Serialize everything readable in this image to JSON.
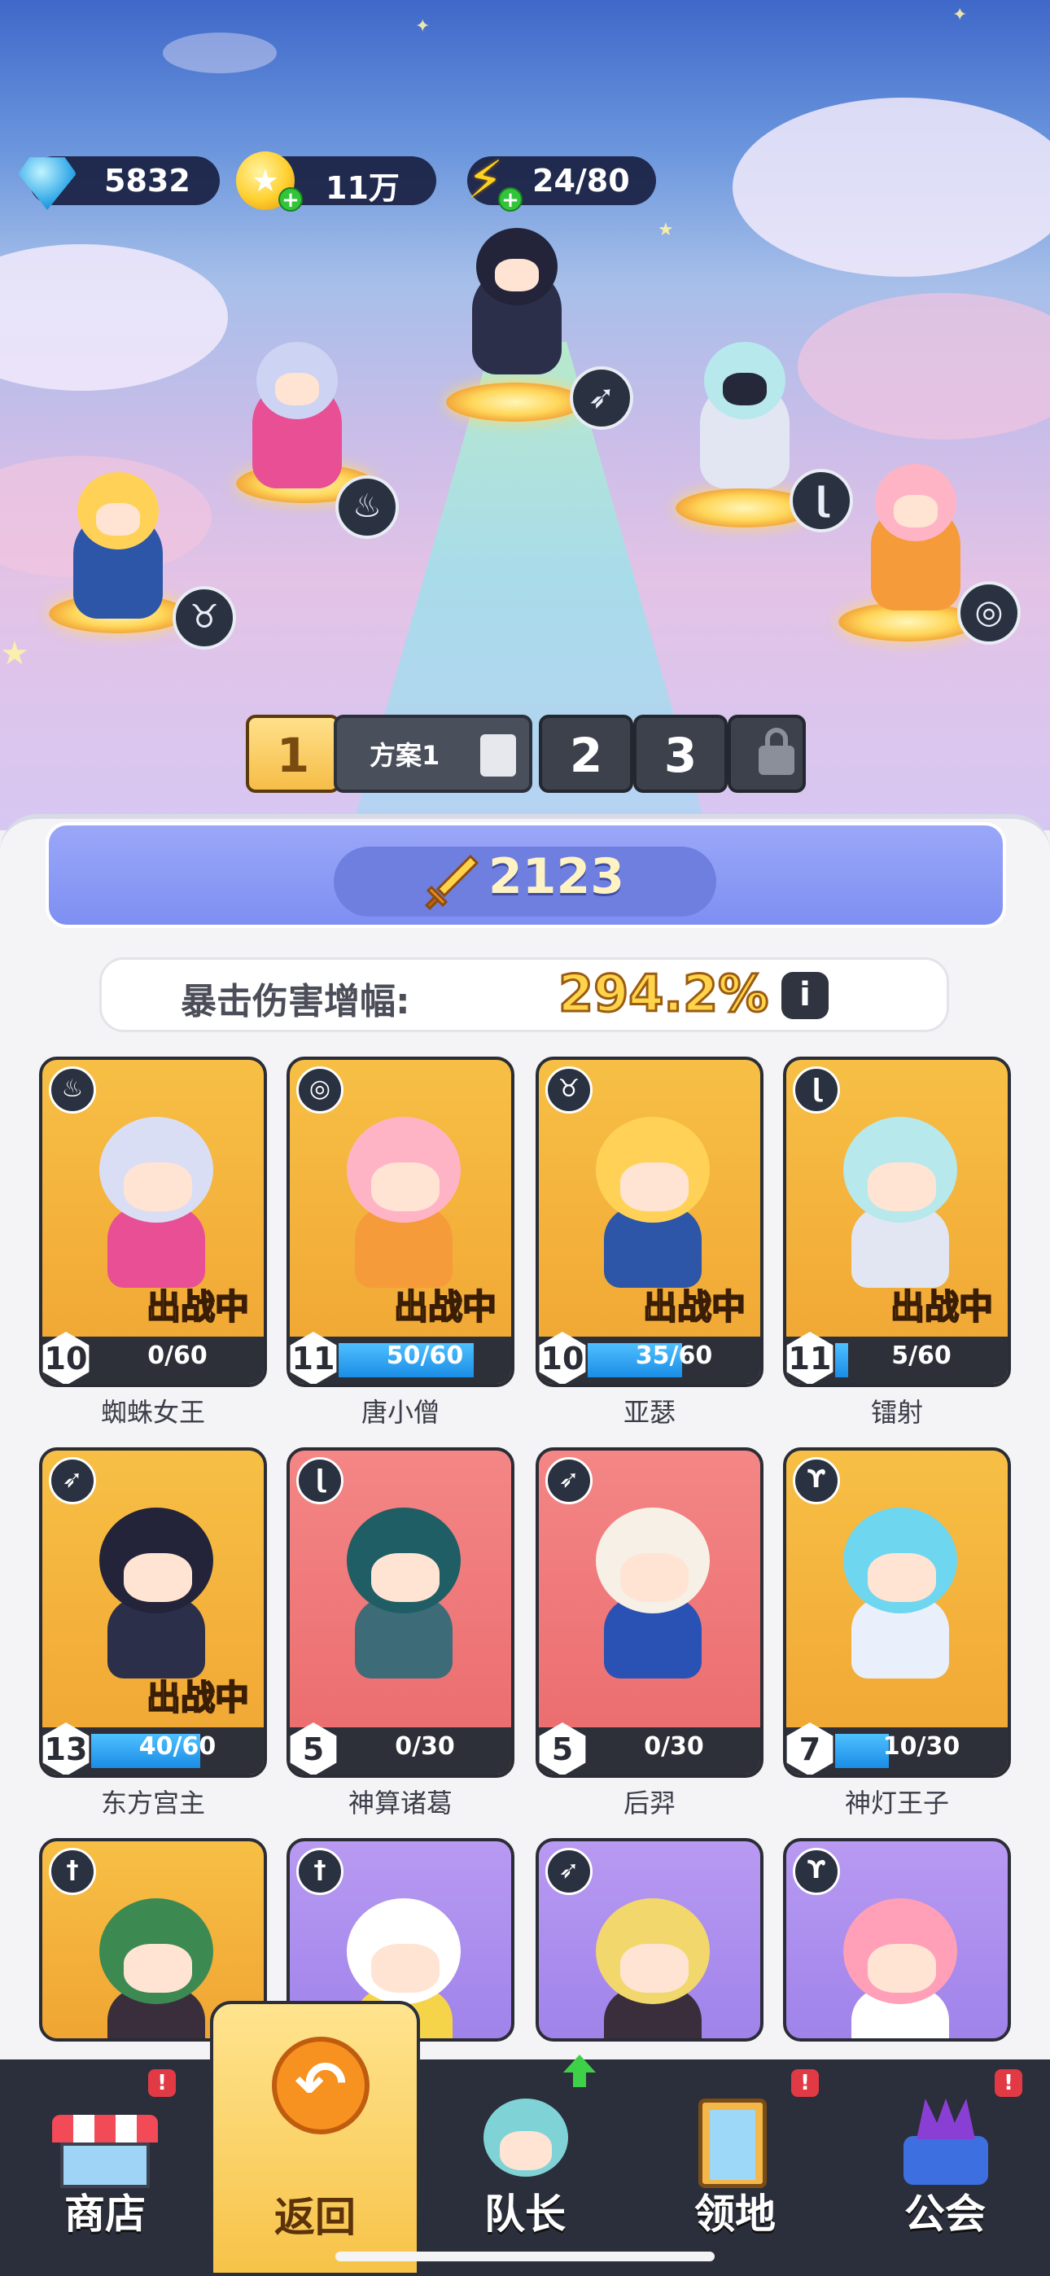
{
  "resources": {
    "gems": "5832",
    "gold": "11万",
    "energy": "24/80"
  },
  "formation": {
    "active_slot": "1",
    "plan_name": "方案1",
    "slot2": "2",
    "slot3": "3"
  },
  "power": "2123",
  "crit": {
    "label": "暴击伤害增幅:",
    "value": "294.2%"
  },
  "heroes": [
    {
      "name": "蜘蛛女王",
      "level": "10",
      "progress": "0/60",
      "ratio": 0.0,
      "deployed_label": "出战中",
      "bg": "gold",
      "class_icon": "potion-icon"
    },
    {
      "name": "唐小僧",
      "level": "11",
      "progress": "50/60",
      "ratio": 0.83,
      "deployed_label": "出战中",
      "bg": "gold",
      "class_icon": "spiral-icon"
    },
    {
      "name": "亚瑟",
      "level": "10",
      "progress": "35/60",
      "ratio": 0.58,
      "deployed_label": "出战中",
      "bg": "gold",
      "class_icon": "ox-icon"
    },
    {
      "name": "镭射",
      "level": "11",
      "progress": "5/60",
      "ratio": 0.08,
      "deployed_label": "出战中",
      "bg": "gold",
      "class_icon": "staff-icon"
    },
    {
      "name": "东方宫主",
      "level": "13",
      "progress": "40/60",
      "ratio": 0.67,
      "deployed_label": "出战中",
      "bg": "gold",
      "class_icon": "bow-icon"
    },
    {
      "name": "神算诸葛",
      "level": "5",
      "progress": "0/30",
      "ratio": 0.0,
      "deployed_label": "",
      "bg": "red",
      "class_icon": "staff-icon"
    },
    {
      "name": "后羿",
      "level": "5",
      "progress": "0/30",
      "ratio": 0.0,
      "deployed_label": "",
      "bg": "red",
      "class_icon": "bow-icon"
    },
    {
      "name": "神灯王子",
      "level": "7",
      "progress": "10/30",
      "ratio": 0.33,
      "deployed_label": "",
      "bg": "gold",
      "class_icon": "wings-icon"
    },
    {
      "name": "",
      "level": "",
      "progress": "",
      "ratio": 0.0,
      "deployed_label": "",
      "bg": "gold",
      "class_icon": "sword-icon"
    },
    {
      "name": "",
      "level": "",
      "progress": "",
      "ratio": 0.0,
      "deployed_label": "",
      "bg": "purple",
      "class_icon": "sword-icon"
    },
    {
      "name": "",
      "level": "",
      "progress": "",
      "ratio": 0.0,
      "deployed_label": "",
      "bg": "purple",
      "class_icon": "bow-icon"
    },
    {
      "name": "",
      "level": "",
      "progress": "",
      "ratio": 0.0,
      "deployed_label": "",
      "bg": "purple",
      "class_icon": "wings-icon"
    }
  ],
  "nav": [
    {
      "label": "商店",
      "icon": "shop-icon",
      "alert": "!"
    },
    {
      "label": "返回",
      "icon": "back-arrow-icon",
      "alert": ""
    },
    {
      "label": "队长",
      "icon": "captain-icon",
      "alert": ""
    },
    {
      "label": "领地",
      "icon": "territory-icon",
      "alert": "!"
    },
    {
      "label": "公会",
      "icon": "guild-icon",
      "alert": "!"
    }
  ],
  "colors": {
    "card_gold": "#f2ac38",
    "card_red": "#ee7476",
    "card_purple": "#ab8cee",
    "bar_fill": "#2aa3f2",
    "nav_bg": "#2b2f3b",
    "active_nav": "#f9cf5d"
  }
}
